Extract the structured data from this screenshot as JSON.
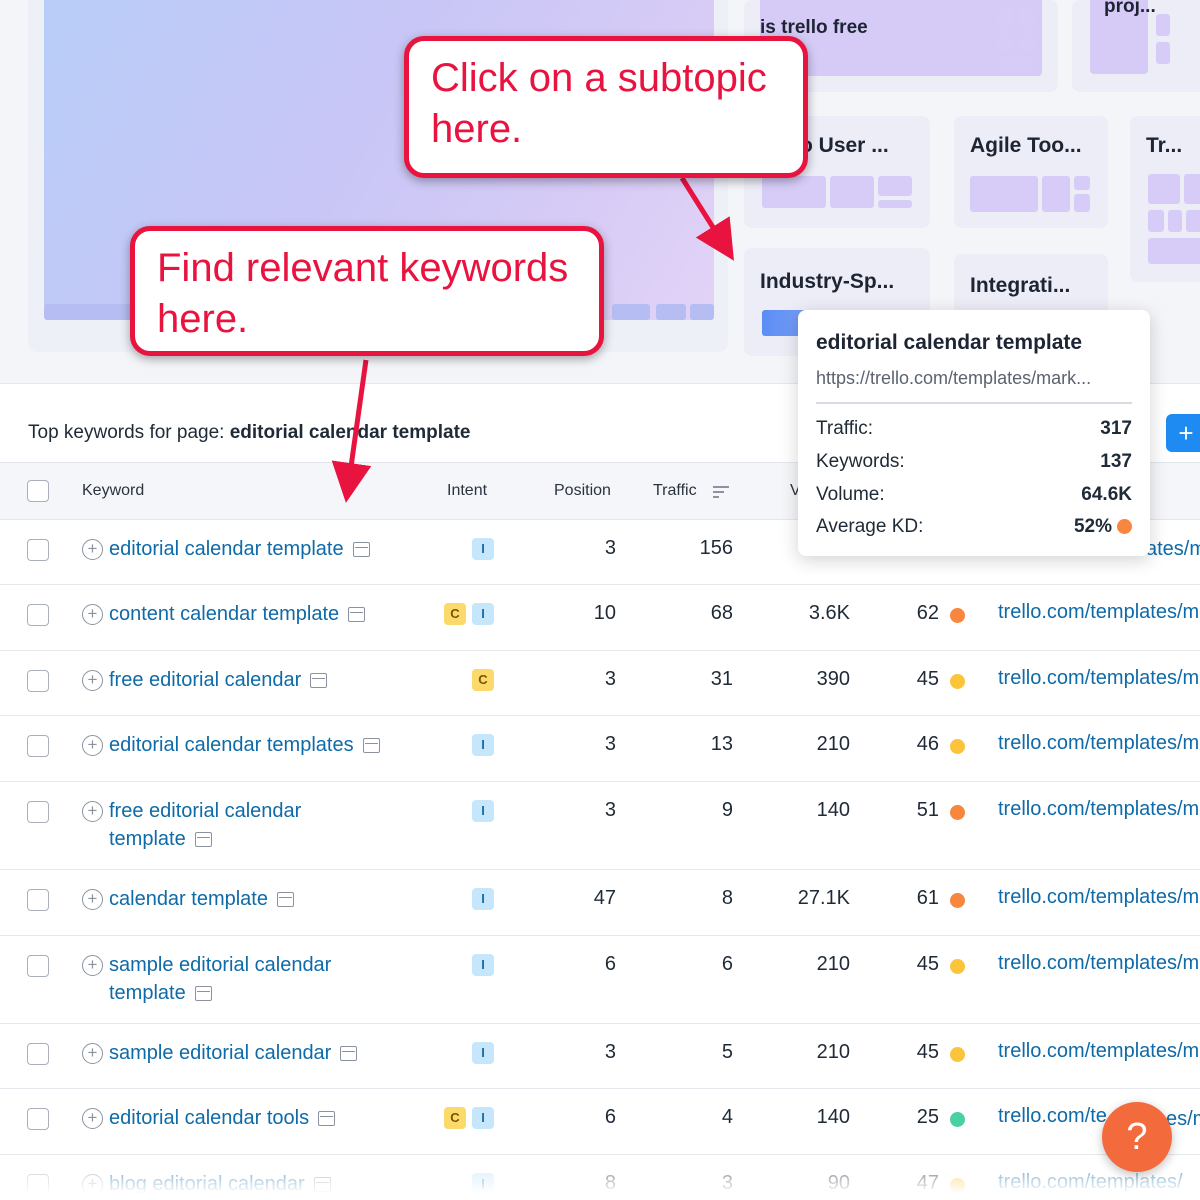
{
  "treemap": {
    "subtopics": [
      {
        "title": "is trello free"
      },
      {
        "title": "proj..."
      },
      {
        "title": "o User ..."
      },
      {
        "title": "Agile Too..."
      },
      {
        "title": "Tr..."
      },
      {
        "title": "Industry-Sp..."
      },
      {
        "title": "Integrati..."
      }
    ]
  },
  "callouts": {
    "subtopic": "Click on a subtopic here.",
    "keywords": "Find relevant keywords here."
  },
  "header": {
    "prefix": "Top keywords for page: ",
    "page": "editorial calendar template",
    "add_icon": "plus-icon",
    "add_label": "+"
  },
  "columns": {
    "keyword": "Keyword",
    "intent": "Intent",
    "position": "Position",
    "traffic": "Traffic",
    "volume_partial": "V"
  },
  "tooltip": {
    "title": "editorial calendar template",
    "url": "https://trello.com/templates/mark...",
    "traffic_label": "Traffic:",
    "traffic": "317",
    "keywords_label": "Keywords:",
    "keywords": "137",
    "volume_label": "Volume:",
    "volume": "64.6K",
    "kd_label": "Average KD:",
    "kd": "52%",
    "kd_color": "#f7863e"
  },
  "first_row_url_fragment": "ates/m",
  "colors": {
    "kd_orange": "#f7863e",
    "kd_yellow": "#fbc43a",
    "kd_green": "#4bd0a0",
    "link": "#0e6aa8",
    "callout": "#e8133f"
  },
  "rows": [
    {
      "keyword": [
        "editorial calendar template"
      ],
      "intents": [
        "I"
      ],
      "position": "3",
      "traffic": "156",
      "volume": "",
      "kd": "",
      "kd_color": "",
      "url": ""
    },
    {
      "keyword": [
        "content calendar template"
      ],
      "intents": [
        "C",
        "I"
      ],
      "position": "10",
      "traffic": "68",
      "volume": "3.6K",
      "kd": "62",
      "kd_color": "#f7863e",
      "url": "trello.com/templates/m"
    },
    {
      "keyword": [
        "free editorial calendar"
      ],
      "intents": [
        "C"
      ],
      "position": "3",
      "traffic": "31",
      "volume": "390",
      "kd": "45",
      "kd_color": "#fbc43a",
      "url": "trello.com/templates/m"
    },
    {
      "keyword": [
        "editorial calendar templates"
      ],
      "intents": [
        "I"
      ],
      "position": "3",
      "traffic": "13",
      "volume": "210",
      "kd": "46",
      "kd_color": "#fbc43a",
      "url": "trello.com/templates/m"
    },
    {
      "keyword": [
        "free editorial calendar",
        "template"
      ],
      "intents": [
        "I"
      ],
      "position": "3",
      "traffic": "9",
      "volume": "140",
      "kd": "51",
      "kd_color": "#f7863e",
      "url": "trello.com/templates/m"
    },
    {
      "keyword": [
        "calendar template"
      ],
      "intents": [
        "I"
      ],
      "position": "47",
      "traffic": "8",
      "volume": "27.1K",
      "kd": "61",
      "kd_color": "#f7863e",
      "url": "trello.com/templates/m"
    },
    {
      "keyword": [
        "sample editorial calendar",
        "template"
      ],
      "intents": [
        "I"
      ],
      "position": "6",
      "traffic": "6",
      "volume": "210",
      "kd": "45",
      "kd_color": "#fbc43a",
      "url": "trello.com/templates/m"
    },
    {
      "keyword": [
        "sample editorial calendar"
      ],
      "intents": [
        "I"
      ],
      "position": "3",
      "traffic": "5",
      "volume": "210",
      "kd": "45",
      "kd_color": "#fbc43a",
      "url": "trello.com/templates/m"
    },
    {
      "keyword": [
        "editorial calendar tools"
      ],
      "intents": [
        "C",
        "I"
      ],
      "position": "6",
      "traffic": "4",
      "volume": "140",
      "kd": "25",
      "kd_color": "#4bd0a0",
      "url": "trello.com/te"
    },
    {
      "keyword": [
        "blog editorial calendar"
      ],
      "intents": [
        "I"
      ],
      "position": "8",
      "traffic": "3",
      "volume": "90",
      "kd": "47",
      "kd_color": "#fbc43a",
      "url": "trello.com/templates/"
    }
  ],
  "last_row_url_suffix": "es/m",
  "help": {
    "label": "?",
    "icon": "question-icon"
  }
}
